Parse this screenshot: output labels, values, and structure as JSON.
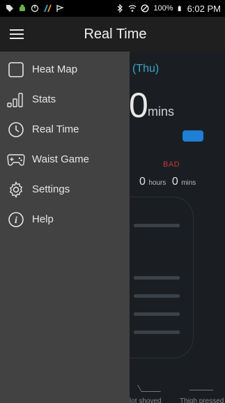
{
  "status_bar": {
    "battery_percent": "100%",
    "time": "6:02 PM"
  },
  "app_bar": {
    "title": "Real Time"
  },
  "drawer": {
    "items": [
      {
        "label": "Heat Map",
        "icon": "square-outline-icon"
      },
      {
        "label": "Stats",
        "icon": "signal-bars-icon"
      },
      {
        "label": "Real Time",
        "icon": "clock-icon"
      },
      {
        "label": "Waist Game",
        "icon": "gamepad-icon"
      },
      {
        "label": "Settings",
        "icon": "gear-icon"
      },
      {
        "label": "Help",
        "icon": "info-icon"
      }
    ]
  },
  "background": {
    "date_fragment": "(Thu)",
    "big_number": "0",
    "big_unit": "mins",
    "status": "BAD",
    "hours_value": "0",
    "hours_unit": "hours",
    "mins_value": "0",
    "mins_unit": "mins",
    "label_a": "lot shoved",
    "label_b": "Thigh pressed"
  },
  "colors": {
    "drawer_bg": "#424242",
    "app_bar_bg": "#1f1f1f",
    "accent_blue": "#1f7fd6",
    "date_teal": "#3aa6c8",
    "bad_red": "#c23a3a"
  }
}
